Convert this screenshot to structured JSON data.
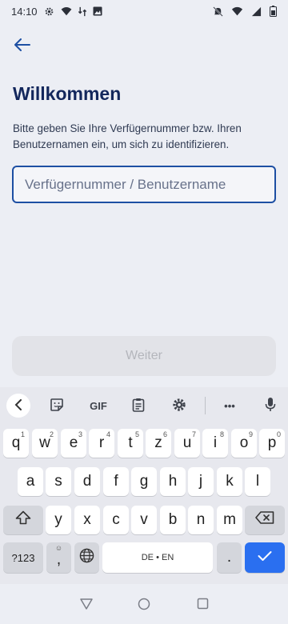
{
  "status_bar": {
    "time": "14:10"
  },
  "header": {
    "back_icon": "arrow-left-icon"
  },
  "main": {
    "title": "Willkommen",
    "subtitle": "Bitte geben Sie Ihre Verfügernummer bzw. Ihren Benutzernamen ein, um sich zu identifizieren.",
    "input": {
      "placeholder": "Verfügernummer / Benutzername",
      "value": ""
    },
    "continue_label": "Weiter"
  },
  "keyboard": {
    "toolbar": {
      "gif_label": "GIF",
      "more_label": "•••"
    },
    "row1": [
      {
        "key": "q",
        "hint": "1"
      },
      {
        "key": "w",
        "hint": "2"
      },
      {
        "key": "e",
        "hint": "3"
      },
      {
        "key": "r",
        "hint": "4"
      },
      {
        "key": "t",
        "hint": "5"
      },
      {
        "key": "z",
        "hint": "6"
      },
      {
        "key": "u",
        "hint": "7"
      },
      {
        "key": "i",
        "hint": "8"
      },
      {
        "key": "o",
        "hint": "9"
      },
      {
        "key": "p",
        "hint": "0"
      }
    ],
    "row2": [
      "a",
      "s",
      "d",
      "f",
      "g",
      "h",
      "j",
      "k",
      "l"
    ],
    "row3": [
      "y",
      "x",
      "c",
      "v",
      "b",
      "n",
      "m"
    ],
    "symbols_label": "?123",
    "comma_label": ",",
    "emoji_hint": "☺",
    "space_label": "DE • EN",
    "period_label": "."
  },
  "colors": {
    "accent": "#1d4fa3",
    "title": "#13275c",
    "enter_key": "#2a6ff0"
  }
}
